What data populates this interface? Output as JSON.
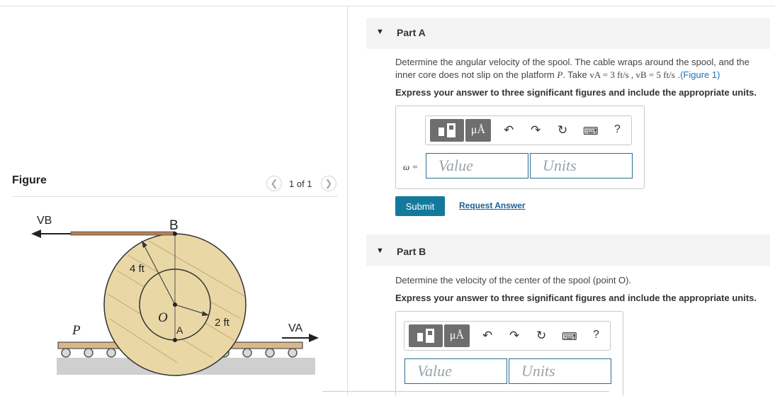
{
  "figure_panel": {
    "title": "Figure",
    "pager": "1 of 1",
    "prev_icon": "chevron-left-icon",
    "next_icon": "chevron-right-icon",
    "diagram_labels": {
      "vb": "VB",
      "b": "B",
      "outer_radius": "4 ft",
      "o": "O",
      "inner_radius": "2 ft",
      "a": "A",
      "p": "P",
      "va": "VA"
    }
  },
  "part_a": {
    "label": "Part A",
    "prompt_text": "Determine the angular velocity of the spool. The cable wraps around the spool, and the inner core does not slip on the platform ",
    "prompt_p": "P",
    "prompt_take": ". Take ",
    "prompt_vals": "vA = 3 ft/s , vB = 5 ft/s",
    "prompt_link": ".(Figure 1)",
    "instruction": "Express your answer to three significant figures and include the appropriate units.",
    "variable": "ω =",
    "value_placeholder": "Value",
    "units_placeholder": "Units",
    "submit_label": "Submit",
    "request_label": "Request Answer"
  },
  "part_b": {
    "label": "Part B",
    "prompt_text": "Determine the velocity of the center of the spool (point O).",
    "instruction": "Express your answer to three significant figures and include the appropriate units.",
    "value_placeholder": "Value",
    "units_placeholder": "Units"
  },
  "toolbar": {
    "templates_icon": "templates-icon",
    "units_button": "μÅ",
    "undo_icon": "undo-icon",
    "redo_icon": "redo-icon",
    "reset_icon": "reset-icon",
    "keyboard_icon": "keyboard-icon",
    "help": "?"
  },
  "colors": {
    "submit": "#137a9c",
    "field_border": "#2a6e91",
    "link": "#1a73b8",
    "spool_fill": "#ead7a6"
  }
}
